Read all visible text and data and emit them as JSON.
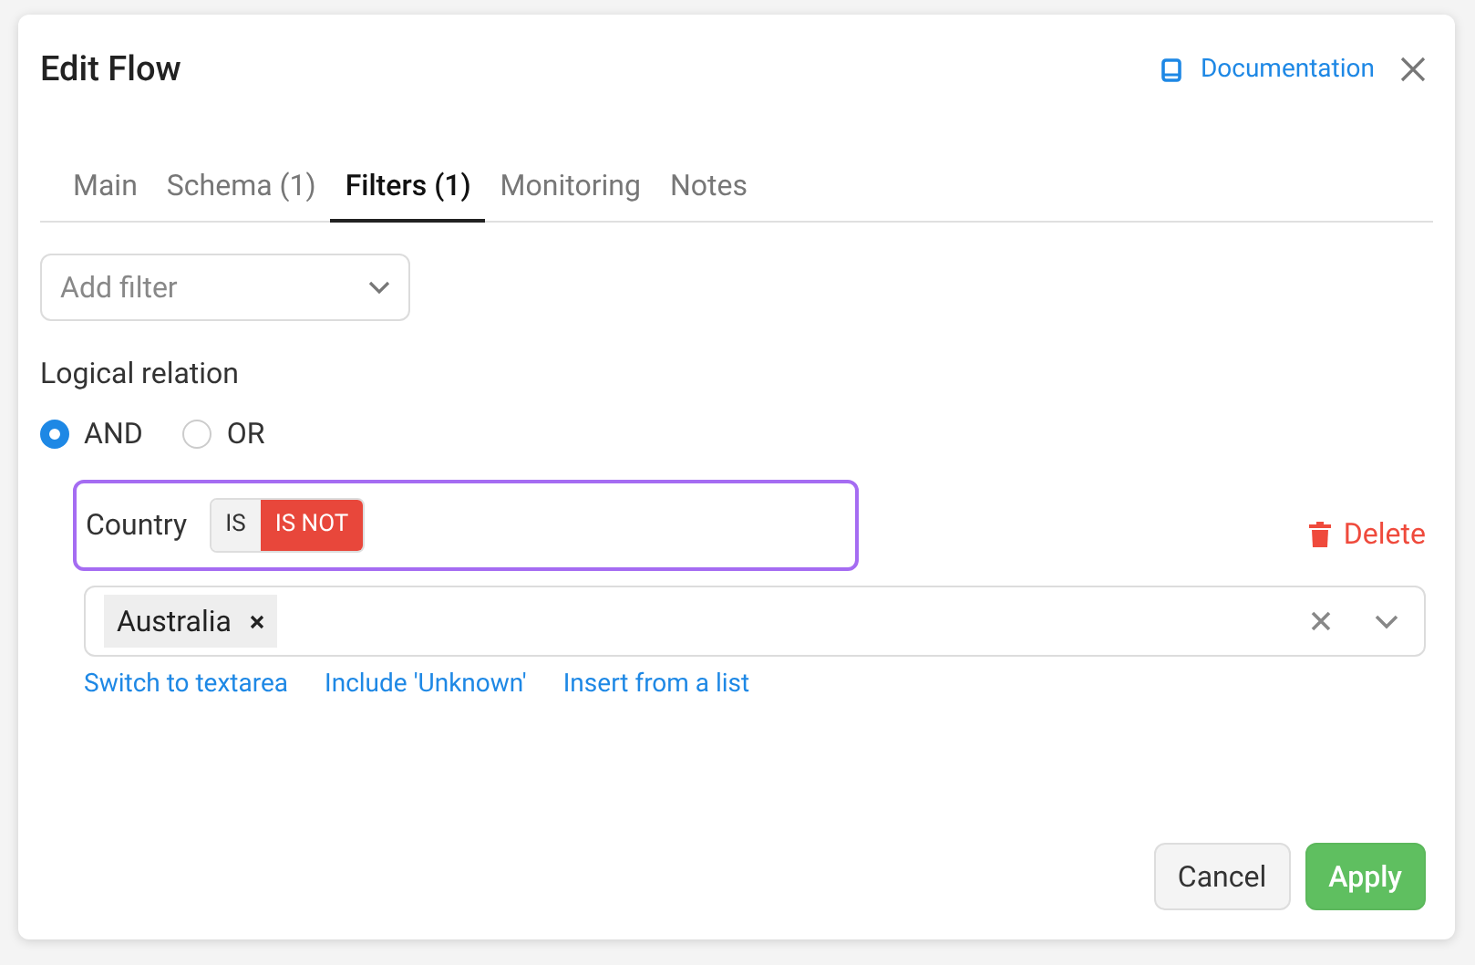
{
  "dialog": {
    "title": "Edit Flow",
    "documentation_link": "Documentation"
  },
  "tabs": [
    {
      "label": "Main",
      "selected": false
    },
    {
      "label": "Schema (1)",
      "selected": false
    },
    {
      "label": "Filters (1)",
      "selected": true
    },
    {
      "label": "Monitoring",
      "selected": false
    },
    {
      "label": "Notes",
      "selected": false
    }
  ],
  "add_filter": {
    "placeholder": "Add filter"
  },
  "logical_relation": {
    "label": "Logical relation",
    "options": [
      {
        "label": "AND",
        "selected": true
      },
      {
        "label": "OR",
        "selected": false
      }
    ]
  },
  "filters": [
    {
      "field": "Country",
      "focused": true,
      "operators": [
        {
          "label": "IS",
          "selected": false
        },
        {
          "label": "IS NOT",
          "selected": true
        }
      ],
      "delete_label": "Delete",
      "values": [
        "Australia"
      ],
      "links": [
        "Switch to textarea",
        "Include 'Unknown'",
        "Insert from a list"
      ]
    }
  ],
  "buttons": [
    {
      "label": "Cancel",
      "kind": "secondary"
    },
    {
      "label": "Apply",
      "kind": "primary"
    }
  ]
}
